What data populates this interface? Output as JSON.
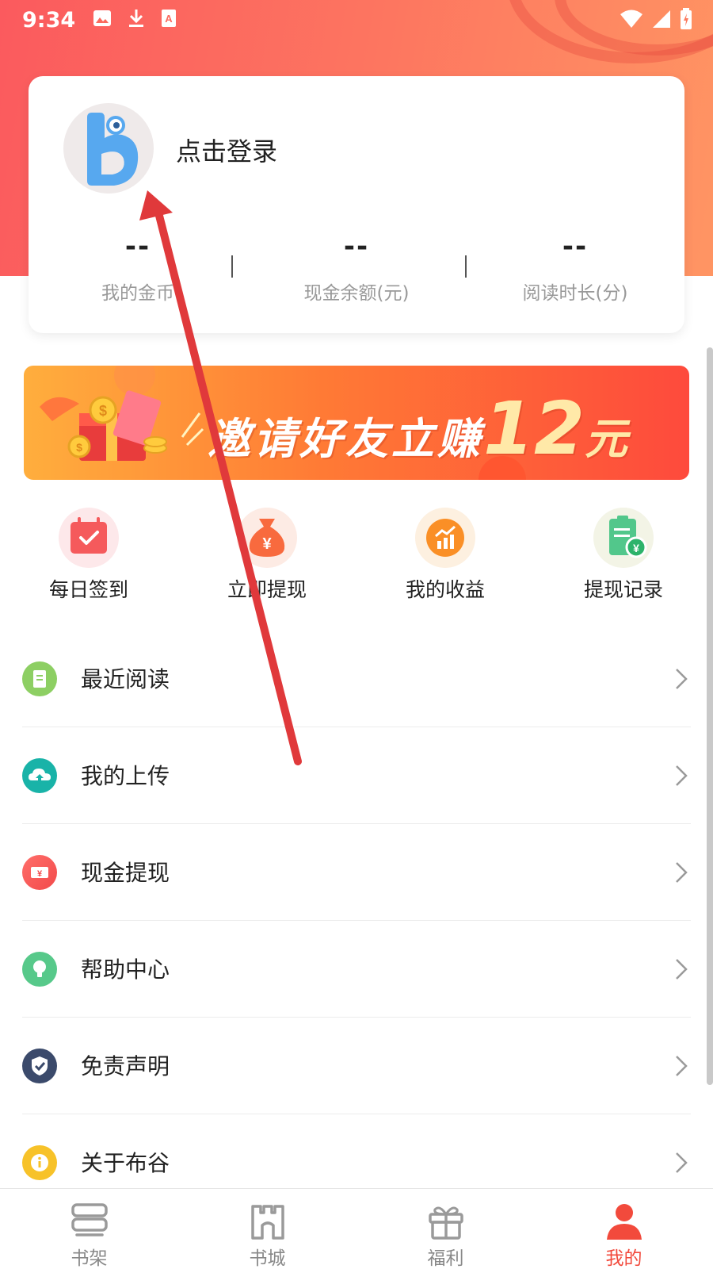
{
  "status_bar": {
    "time": "9:34"
  },
  "profile": {
    "login_prompt": "点击登录",
    "stats": [
      {
        "value": "--",
        "label": "我的金币"
      },
      {
        "value": "--",
        "label": "现金余额(元)"
      },
      {
        "value": "--",
        "label": "阅读时长(分)"
      }
    ]
  },
  "banner": {
    "text": "邀请好友立赚",
    "amount": "12",
    "unit": "元"
  },
  "quick_actions": [
    {
      "label": "每日签到",
      "icon": "calendar-check-icon"
    },
    {
      "label": "立即提现",
      "icon": "money-bag-icon"
    },
    {
      "label": "我的收益",
      "icon": "chart-up-icon"
    },
    {
      "label": "提现记录",
      "icon": "clipboard-yen-icon"
    }
  ],
  "menu": [
    {
      "label": "最近阅读",
      "icon": "recent-reading-icon",
      "color": "#8dcf63"
    },
    {
      "label": "我的上传",
      "icon": "cloud-upload-icon",
      "color": "#19b3a8"
    },
    {
      "label": "现金提现",
      "icon": "cash-ticket-icon",
      "color": "#f45a57"
    },
    {
      "label": "帮助中心",
      "icon": "lightbulb-icon",
      "color": "#57c98a"
    },
    {
      "label": "免责声明",
      "icon": "shield-check-icon",
      "color": "#3b4a6b"
    },
    {
      "label": "关于布谷",
      "icon": "info-icon",
      "color": "#f7c229"
    }
  ],
  "tabbar": [
    {
      "label": "书架",
      "icon": "bookshelf-icon",
      "active": false
    },
    {
      "label": "书城",
      "icon": "book-city-icon",
      "active": false
    },
    {
      "label": "福利",
      "icon": "gift-icon",
      "active": false
    },
    {
      "label": "我的",
      "icon": "profile-icon",
      "active": true
    }
  ],
  "colors": {
    "accent": "#f24a3c",
    "header_start": "#fb5a5e",
    "header_end": "#ff9563"
  }
}
